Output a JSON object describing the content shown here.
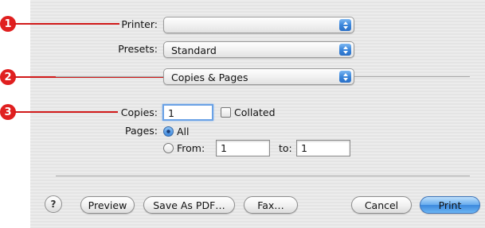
{
  "callouts": [
    "1",
    "2",
    "3"
  ],
  "printer": {
    "label": "Printer:",
    "value": ""
  },
  "presets": {
    "label": "Presets:",
    "value": "Standard"
  },
  "panel": {
    "value": "Copies & Pages"
  },
  "copies": {
    "label": "Copies:",
    "value": "1",
    "collated_label": "Collated",
    "collated": false
  },
  "pages": {
    "label": "Pages:",
    "all_label": "All",
    "all_selected": true,
    "from_label": "From:",
    "from_value": "1",
    "to_label": "to:",
    "to_value": "1"
  },
  "buttons": {
    "help": "?",
    "preview": "Preview",
    "save_pdf": "Save As PDF…",
    "fax": "Fax…",
    "cancel": "Cancel",
    "print": "Print"
  },
  "colors": {
    "callout": "#e01f1f",
    "accent": "#3c88dd"
  }
}
